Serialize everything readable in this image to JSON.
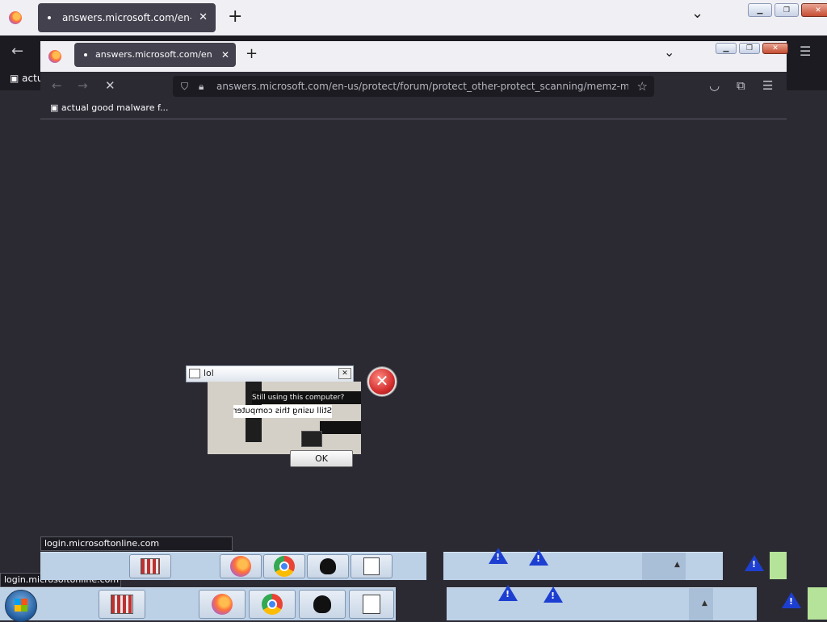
{
  "outer_browser": {
    "tab_title": "answers.microsoft.com/en-us/",
    "new_tab_label": "+",
    "list_all_tabs": "⌄",
    "close_tab": "✕",
    "back": "←",
    "bookmark_partial": "actu",
    "menu": "☰"
  },
  "inner_browser": {
    "tab_title": "answers.microsoft.com/en-us/",
    "close_tab": "✕",
    "new_tab_label": "+",
    "list_all_tabs": "⌄",
    "back": "←",
    "forward": "→",
    "stop": "✕",
    "url": "answers.microsoft.com/en-us/protect/forum/protect_other-protect_scanning/memz-malware",
    "bookmark_label": "actual good malware f...",
    "star": "☆",
    "menu": "☰"
  },
  "dialog": {
    "title": "lol",
    "close": "✕",
    "line1": "Still using this computer?",
    "line1_mirrored": "Still using this computer?",
    "ok_label": "OK",
    "error_icon": "✕"
  },
  "status": {
    "upper": "login.microsoftonline.com",
    "lower": "login.microsoftonline.com"
  },
  "taskbar": {
    "start_icon": "windows-orb",
    "apps": [
      "file-manager-icon",
      "firefox-icon",
      "chrome-icon",
      "paint-icon",
      "notepad-icon"
    ],
    "warning_glyph": "!"
  }
}
